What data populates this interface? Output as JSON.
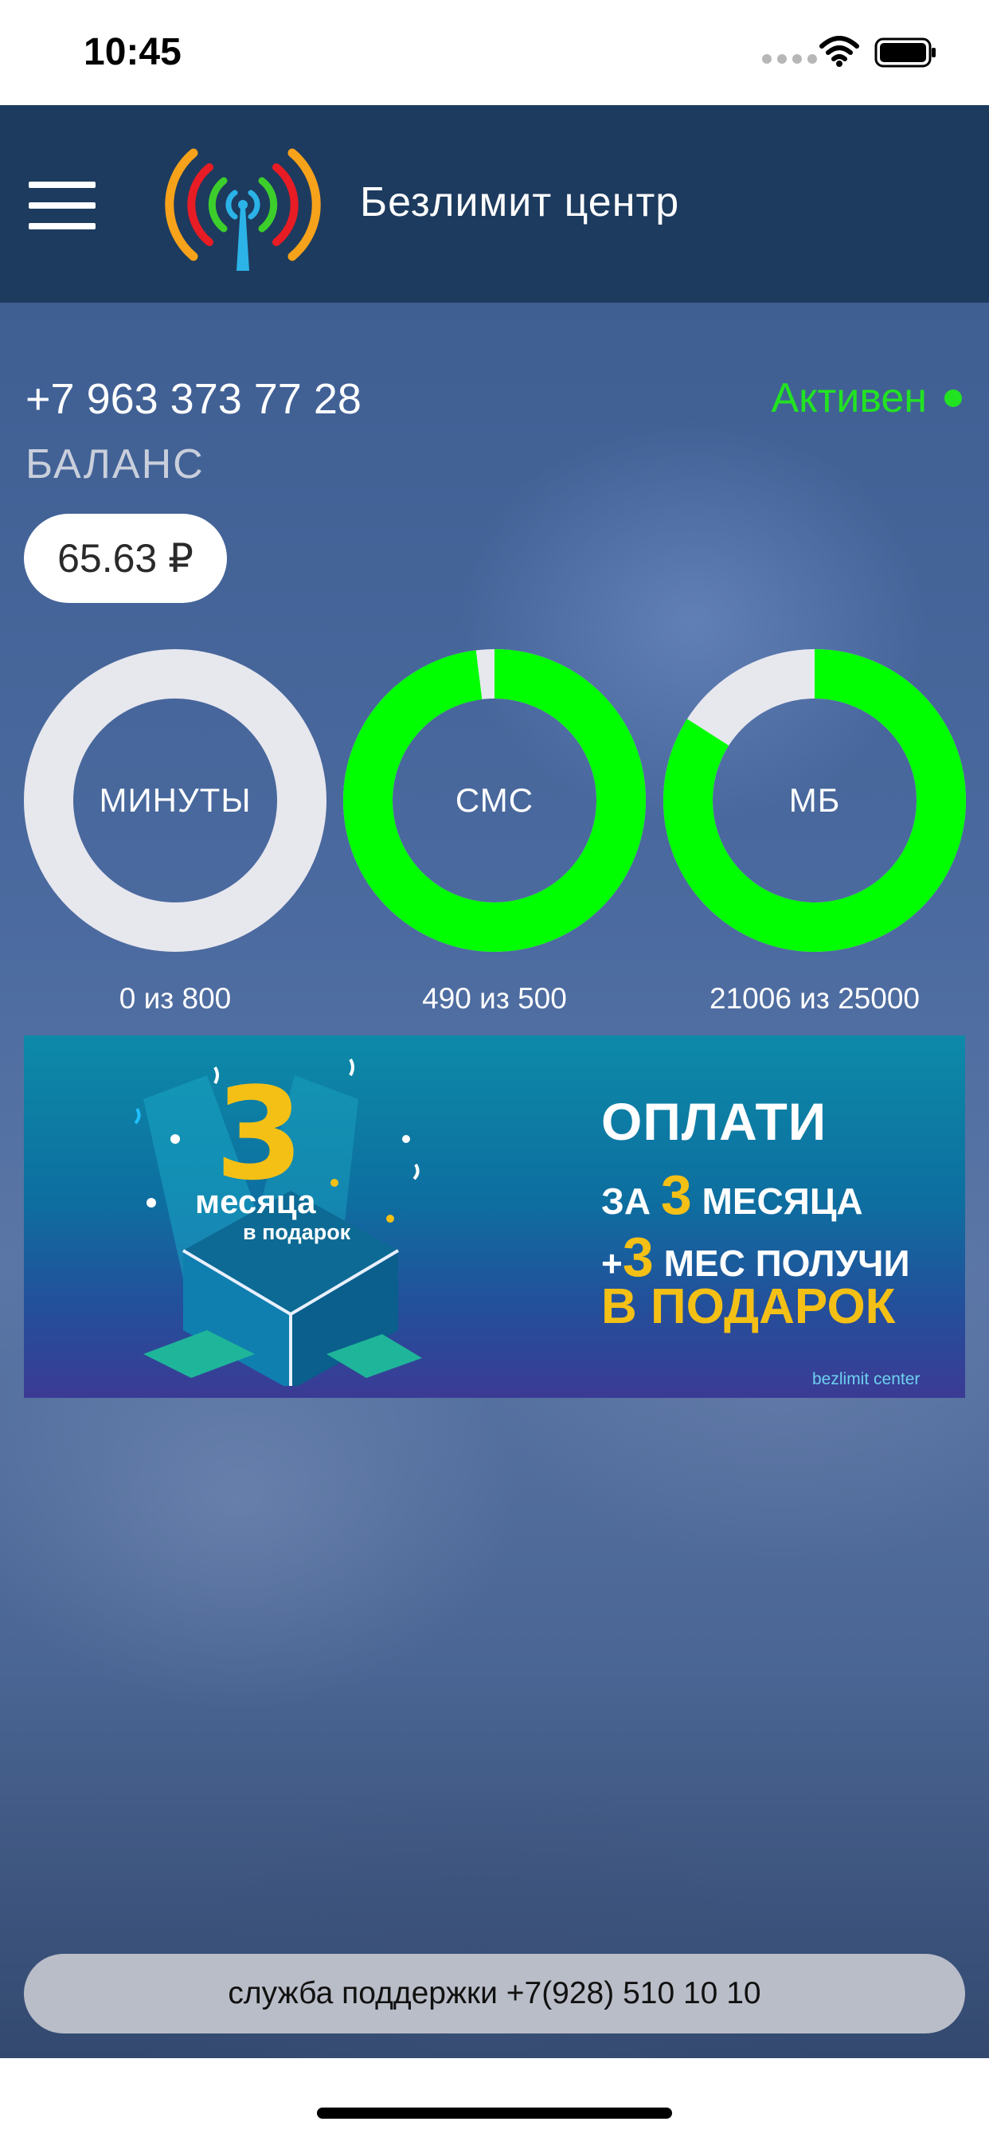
{
  "status_bar": {
    "time": "10:45"
  },
  "header": {
    "title": "Безлимит центр"
  },
  "account": {
    "phone": "+7 963 373 77 28",
    "status": "Активен",
    "balance_label": "БАЛАНС",
    "balance_value": "65.63 ₽"
  },
  "usage": [
    {
      "label": "МИНУТЫ",
      "caption": "0 из 800",
      "used": 0,
      "total": 800
    },
    {
      "label": "СМС",
      "caption": "490 из 500",
      "used": 490,
      "total": 500
    },
    {
      "label": "МБ",
      "caption": "21006 из 25000",
      "used": 21006,
      "total": 25000
    }
  ],
  "banner": {
    "promo_number": "3",
    "promo_months": "месяца",
    "promo_gift": "в подарок",
    "line1": "ОПЛАТИ",
    "line2_pre": "ЗА ",
    "line2_num": "3",
    "line2_post": " МЕСЯЦА",
    "line3_pre": "+",
    "line3_num": "3",
    "line3_post": " МЕС ПОЛУЧИ",
    "line4": "В ПОДАРОК",
    "brand": "bezlimit center"
  },
  "support": {
    "label": "служба поддержки +7(928) 510 10 10"
  },
  "colors": {
    "header_bg": "#1d3b5e",
    "ring_fill": "#00ff00",
    "ring_track": "#e7e7ee",
    "active_green": "#22e322",
    "banner_accent": "#f4c016"
  }
}
